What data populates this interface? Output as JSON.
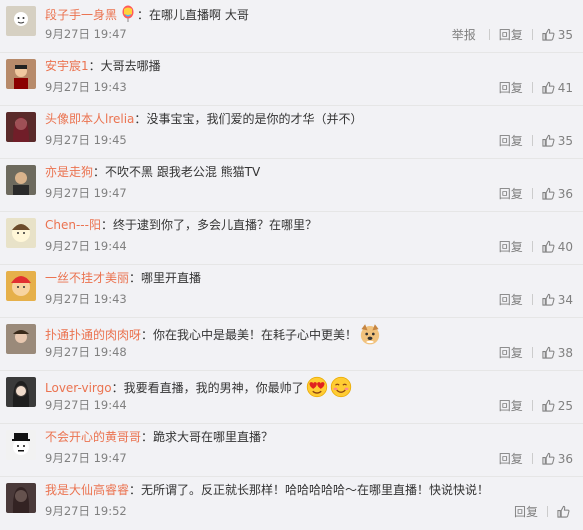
{
  "labels": {
    "reply": "回复",
    "report": "举报",
    "colon": "："
  },
  "comments": [
    {
      "user": "段子手一身黑",
      "badge": "balloon",
      "text": "在哪儿直播啊 大哥",
      "time": "9月27日 19:47",
      "likes": "35",
      "show_report": true,
      "emojis": [],
      "avatar_color": "#d6d0c2"
    },
    {
      "user": "安宇宸1",
      "text": "大哥去哪播",
      "time": "9月27日 19:43",
      "likes": "41",
      "show_report": false,
      "emojis": [],
      "avatar_color": "#b78a6a"
    },
    {
      "user": "头像即本人lrelia",
      "text": "没事宝宝，我们爱的是你的才华（并不）",
      "time": "9月27日 19:45",
      "likes": "35",
      "show_report": false,
      "emojis": [],
      "avatar_color": "#5a2a2a"
    },
    {
      "user": "亦是走狗",
      "text": "不吹不黑 跟我老公混 熊猫TV",
      "time": "9月27日 19:47",
      "likes": "36",
      "show_report": false,
      "emojis": [],
      "avatar_color": "#6d6a5e"
    },
    {
      "user": "Chen---阳",
      "text": "终于逮到你了，多会儿直播？在哪里？",
      "time": "9月27日 19:44",
      "likes": "40",
      "show_report": false,
      "emojis": [],
      "avatar_color": "#e8e2c8"
    },
    {
      "user": "一丝不挂才美丽",
      "text": "哪里开直播",
      "time": "9月27日 19:43",
      "likes": "34",
      "show_report": false,
      "emojis": [],
      "avatar_color": "#e6b04a"
    },
    {
      "user": "扑通扑通的肉肉呀",
      "text": "你在我心中是最美！在耗子心中更美！",
      "time": "9月27日 19:48",
      "likes": "38",
      "show_report": false,
      "emojis": [
        "dog-face"
      ],
      "avatar_color": "#9a8a7a"
    },
    {
      "user": "Lover-virgo",
      "text": "我要看直播，我的男神，你最帅了",
      "time": "9月27日 19:44",
      "likes": "25",
      "show_report": false,
      "emojis": [
        "heart-eyes",
        "smile-blush"
      ],
      "avatar_color": "#3a3a3a"
    },
    {
      "user": "不会开心的黄哥哥",
      "text": "跪求大哥在哪里直播？",
      "time": "9月27日 19:47",
      "likes": "36",
      "show_report": false,
      "emojis": [],
      "avatar_color": "#f2f2f2"
    },
    {
      "user": "我是大仙高睿睿",
      "text": "无所谓了。反正就长那样！哈哈哈哈哈～在哪里直播！快说快说！",
      "time": "9月27日 19:52",
      "likes": "",
      "show_report": false,
      "emojis": [],
      "avatar_color": "#4a3a3a"
    }
  ]
}
